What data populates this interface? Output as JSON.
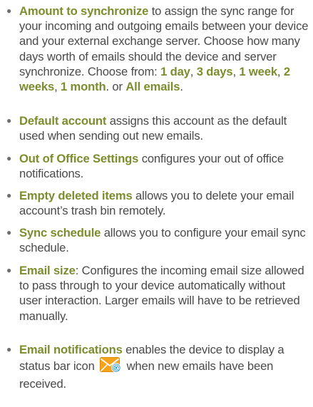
{
  "colors": {
    "body_text": "#4a4a4a",
    "term_text": "#7d8c2d",
    "icon_orange": "#f5a31a",
    "icon_blue": "#1a8fc9"
  },
  "items": [
    {
      "term": "Amount to synchronize",
      "desc": " to assign the sync range for your incoming and outgoing emails between your device and your external exchange server. Choose how many days worth of emails should the device and server synchronize. Choose from: ",
      "options": [
        "1 day",
        "3 days",
        "1 week",
        "2 weeks",
        "1 month"
      ],
      "option_seps": [
        ", ",
        ", ",
        ", ",
        ", "
      ],
      "options_tail": ". or ",
      "last_option": "All emails",
      "end": "."
    },
    {
      "term": "Default account",
      "desc": " assigns this account as the default used when sending out new emails."
    },
    {
      "term": "Out of Office Settings",
      "desc": " configures your out of office notifications."
    },
    {
      "term": "Empty deleted items",
      "desc": " allows you to delete your email account’s trash bin remotely."
    },
    {
      "term": "Sync schedule",
      "desc": " allows you to configure your email sync schedule."
    },
    {
      "term": "Email size",
      "desc": ": Configures the incoming email size allowed to pass through to your device automatically without user interaction. Larger emails will have to be retrieved manually."
    },
    {
      "term": "Email notifications",
      "desc": " enables the device to display a status bar icon ",
      "icon": "email-notification-icon",
      "desc_after": " when new emails have been received."
    }
  ]
}
